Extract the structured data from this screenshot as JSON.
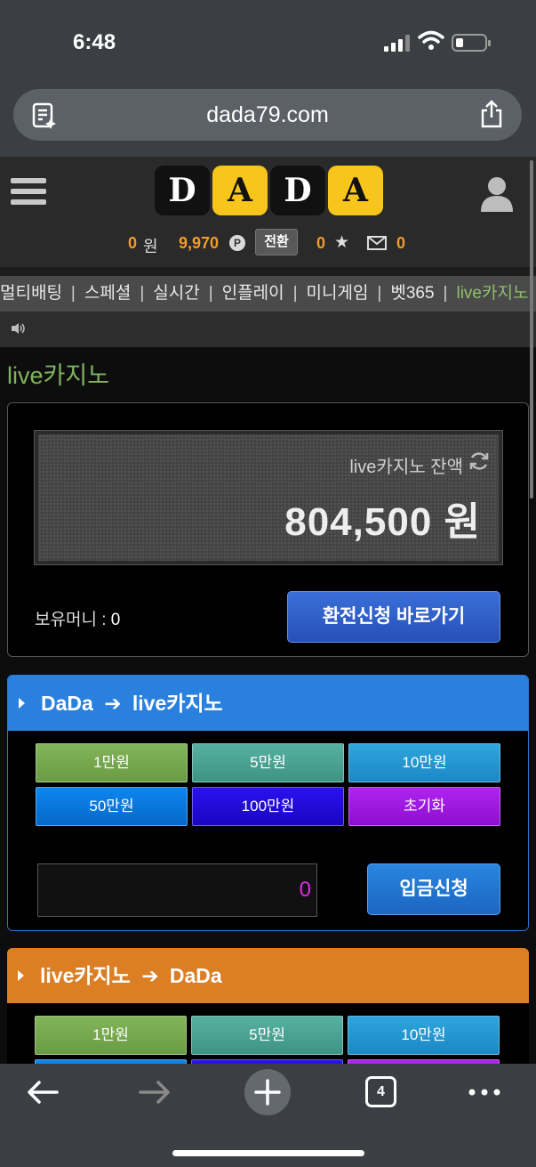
{
  "status_bar": {
    "time": "6:48"
  },
  "browser": {
    "url": "dada79.com",
    "tab_count": "4"
  },
  "header": {
    "logo_letters": [
      "D",
      "A",
      "D",
      "A"
    ],
    "cash_value": "0",
    "cash_unit": "원",
    "points_value": "9,970",
    "points_icon": "P",
    "convert_label": "전환",
    "stars_value": "0",
    "messages_value": "0"
  },
  "nav": {
    "items": [
      "멀티배팅",
      "스페셜",
      "실시간",
      "인플레이",
      "미니게임",
      "벳365",
      "live카지노"
    ],
    "separator": "|"
  },
  "page": {
    "title": "live카지노",
    "balance_label": "live카지노 잔액",
    "balance_value": "804,500 원",
    "held_money_label": "보유머니 : ",
    "held_money_value": "0",
    "exchange_button": "환전신청 바로가기"
  },
  "deposit_panel": {
    "title_from": "DaDa",
    "title_arrow": "➔",
    "title_to": "live카지노",
    "amounts": [
      "1만원",
      "5만원",
      "10만원",
      "50만원",
      "100만원",
      "초기화"
    ],
    "input_value": "0",
    "submit_button": "입금신청"
  },
  "withdraw_panel": {
    "title_from": "live카지노",
    "title_arrow": "➔",
    "title_to": "DaDa",
    "amounts": [
      "1만원",
      "5만원",
      "10만원"
    ]
  },
  "colors": {
    "accent_orange": "#f29a2e",
    "title_green": "#7fb45e",
    "deposit_header": "#2a80dd",
    "withdraw_header": "#dc7e23",
    "logo_yellow": "#f7c51b"
  }
}
